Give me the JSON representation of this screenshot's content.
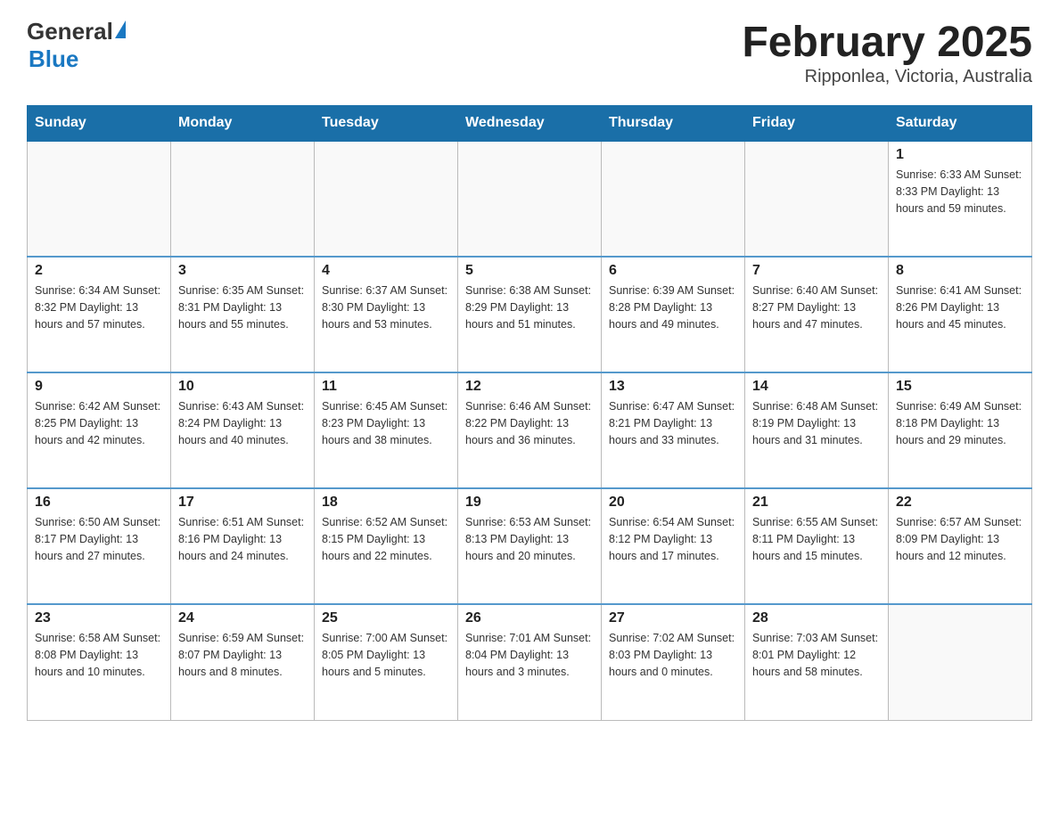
{
  "header": {
    "logo_general": "General",
    "logo_blue": "Blue",
    "title": "February 2025",
    "subtitle": "Ripponlea, Victoria, Australia"
  },
  "calendar": {
    "days_of_week": [
      "Sunday",
      "Monday",
      "Tuesday",
      "Wednesday",
      "Thursday",
      "Friday",
      "Saturday"
    ],
    "weeks": [
      [
        {
          "date": "",
          "info": ""
        },
        {
          "date": "",
          "info": ""
        },
        {
          "date": "",
          "info": ""
        },
        {
          "date": "",
          "info": ""
        },
        {
          "date": "",
          "info": ""
        },
        {
          "date": "",
          "info": ""
        },
        {
          "date": "1",
          "info": "Sunrise: 6:33 AM\nSunset: 8:33 PM\nDaylight: 13 hours and 59 minutes."
        }
      ],
      [
        {
          "date": "2",
          "info": "Sunrise: 6:34 AM\nSunset: 8:32 PM\nDaylight: 13 hours and 57 minutes."
        },
        {
          "date": "3",
          "info": "Sunrise: 6:35 AM\nSunset: 8:31 PM\nDaylight: 13 hours and 55 minutes."
        },
        {
          "date": "4",
          "info": "Sunrise: 6:37 AM\nSunset: 8:30 PM\nDaylight: 13 hours and 53 minutes."
        },
        {
          "date": "5",
          "info": "Sunrise: 6:38 AM\nSunset: 8:29 PM\nDaylight: 13 hours and 51 minutes."
        },
        {
          "date": "6",
          "info": "Sunrise: 6:39 AM\nSunset: 8:28 PM\nDaylight: 13 hours and 49 minutes."
        },
        {
          "date": "7",
          "info": "Sunrise: 6:40 AM\nSunset: 8:27 PM\nDaylight: 13 hours and 47 minutes."
        },
        {
          "date": "8",
          "info": "Sunrise: 6:41 AM\nSunset: 8:26 PM\nDaylight: 13 hours and 45 minutes."
        }
      ],
      [
        {
          "date": "9",
          "info": "Sunrise: 6:42 AM\nSunset: 8:25 PM\nDaylight: 13 hours and 42 minutes."
        },
        {
          "date": "10",
          "info": "Sunrise: 6:43 AM\nSunset: 8:24 PM\nDaylight: 13 hours and 40 minutes."
        },
        {
          "date": "11",
          "info": "Sunrise: 6:45 AM\nSunset: 8:23 PM\nDaylight: 13 hours and 38 minutes."
        },
        {
          "date": "12",
          "info": "Sunrise: 6:46 AM\nSunset: 8:22 PM\nDaylight: 13 hours and 36 minutes."
        },
        {
          "date": "13",
          "info": "Sunrise: 6:47 AM\nSunset: 8:21 PM\nDaylight: 13 hours and 33 minutes."
        },
        {
          "date": "14",
          "info": "Sunrise: 6:48 AM\nSunset: 8:19 PM\nDaylight: 13 hours and 31 minutes."
        },
        {
          "date": "15",
          "info": "Sunrise: 6:49 AM\nSunset: 8:18 PM\nDaylight: 13 hours and 29 minutes."
        }
      ],
      [
        {
          "date": "16",
          "info": "Sunrise: 6:50 AM\nSunset: 8:17 PM\nDaylight: 13 hours and 27 minutes."
        },
        {
          "date": "17",
          "info": "Sunrise: 6:51 AM\nSunset: 8:16 PM\nDaylight: 13 hours and 24 minutes."
        },
        {
          "date": "18",
          "info": "Sunrise: 6:52 AM\nSunset: 8:15 PM\nDaylight: 13 hours and 22 minutes."
        },
        {
          "date": "19",
          "info": "Sunrise: 6:53 AM\nSunset: 8:13 PM\nDaylight: 13 hours and 20 minutes."
        },
        {
          "date": "20",
          "info": "Sunrise: 6:54 AM\nSunset: 8:12 PM\nDaylight: 13 hours and 17 minutes."
        },
        {
          "date": "21",
          "info": "Sunrise: 6:55 AM\nSunset: 8:11 PM\nDaylight: 13 hours and 15 minutes."
        },
        {
          "date": "22",
          "info": "Sunrise: 6:57 AM\nSunset: 8:09 PM\nDaylight: 13 hours and 12 minutes."
        }
      ],
      [
        {
          "date": "23",
          "info": "Sunrise: 6:58 AM\nSunset: 8:08 PM\nDaylight: 13 hours and 10 minutes."
        },
        {
          "date": "24",
          "info": "Sunrise: 6:59 AM\nSunset: 8:07 PM\nDaylight: 13 hours and 8 minutes."
        },
        {
          "date": "25",
          "info": "Sunrise: 7:00 AM\nSunset: 8:05 PM\nDaylight: 13 hours and 5 minutes."
        },
        {
          "date": "26",
          "info": "Sunrise: 7:01 AM\nSunset: 8:04 PM\nDaylight: 13 hours and 3 minutes."
        },
        {
          "date": "27",
          "info": "Sunrise: 7:02 AM\nSunset: 8:03 PM\nDaylight: 13 hours and 0 minutes."
        },
        {
          "date": "28",
          "info": "Sunrise: 7:03 AM\nSunset: 8:01 PM\nDaylight: 12 hours and 58 minutes."
        },
        {
          "date": "",
          "info": ""
        }
      ]
    ]
  }
}
